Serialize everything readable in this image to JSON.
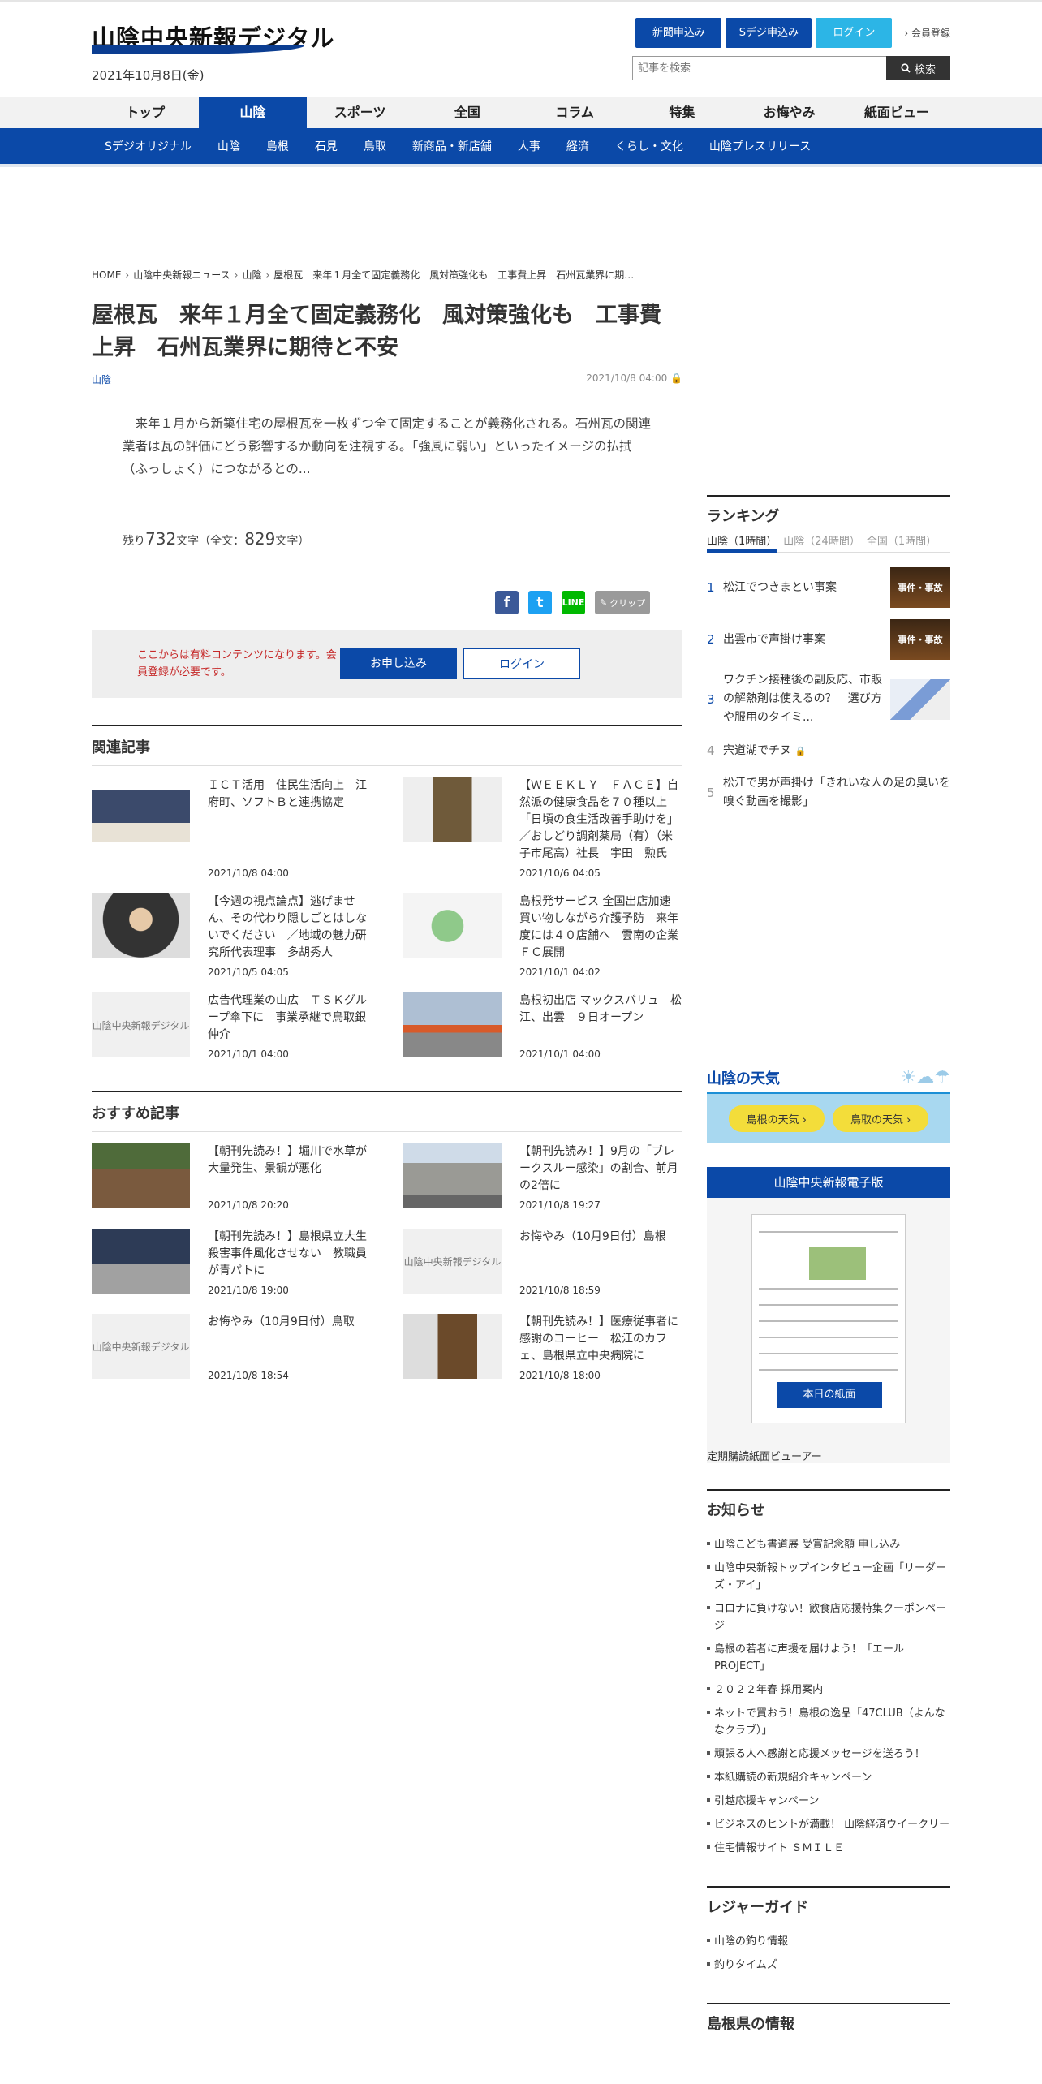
{
  "header": {
    "logo": "山陰中央新報デジタル",
    "date": "2021年10月8日(金)",
    "btn_subscribe": "新聞申込み",
    "btn_sdigi": "Sデジ申込み",
    "btn_login": "ログイン",
    "member": "会員登録",
    "search_placeholder": "記事を検索",
    "search_btn": "検索"
  },
  "gnav": [
    "トップ",
    "山陰",
    "スポーツ",
    "全国",
    "コラム",
    "特集",
    "お悔やみ",
    "紙面ビュー"
  ],
  "snav": [
    "Sデジオリジナル",
    "山陰",
    "島根",
    "石見",
    "鳥取",
    "新商品・新店舗",
    "人事",
    "経済",
    "くらし・文化",
    "山陰プレスリリース"
  ],
  "breadcrumb": [
    "HOME",
    "山陰中央新報ニュース",
    "山陰",
    "屋根瓦　来年１月全て固定義務化　風対策強化も　工事費上昇　石州瓦業界に期…"
  ],
  "article": {
    "title": "屋根瓦　来年１月全て固定義務化　風対策強化も　工事費上昇　石州瓦業界に期待と不安",
    "category": "山陰",
    "timestamp": "2021/10/8 04:00",
    "lead": "来年１月から新築住宅の屋根瓦を一枚ずつ全て固定することが義務化される。石州瓦の関連業者は瓦の評価にどう影響するか動向を注視する。「強風に弱い」といったイメージの払拭（ふっしょく）につながるとの...",
    "remain_pre": "残り",
    "remain_num": "732",
    "remain_mid": "文字（全文：",
    "total_num": "829",
    "remain_post": "文字）",
    "clip": "クリップ",
    "paywall_msg": "ここからは有料コンテンツになります。会員登録が必要です。",
    "apply": "お申し込み",
    "login": "ログイン"
  },
  "related": {
    "title": "関連記事",
    "items": [
      {
        "title": "ＩＣＴ活用　住民生活向上　江府町、ソフトＢと連携協定",
        "date": "2021/10/8 04:00"
      },
      {
        "title": "【ＷＥＥＫＬＹ　ＦＡＣＥ】自然派の健康食品を７０種以上「日頃の食生活改善手助けを」　／おしどり調剤薬局（有）（米子市尾高）社長　宇田　勲氏",
        "date": "2021/10/6 04:05"
      },
      {
        "title": "【今週の視点論点】逃げません、その代わり隠しごとはしないでください　／地域の魅力研究所代表理事　多胡秀人",
        "date": "2021/10/5 04:05"
      },
      {
        "title": "島根発サービス 全国出店加速 買い物しながら介護予防　来年度には４０店舗へ　雲南の企業ＦＣ展開",
        "date": "2021/10/1 04:02"
      },
      {
        "title": "広告代理業の山広　ＴＳＫグループ傘下に　事業承継で鳥取銀仲介",
        "date": "2021/10/1 04:00"
      },
      {
        "title": "島根初出店 マックスバリュ　松江、出雲　９日オープン",
        "date": "2021/10/1 04:00"
      }
    ]
  },
  "recommended": {
    "title": "おすすめ記事",
    "items": [
      {
        "title": "【朝刊先読み！】堀川で水草が大量発生、景観が悪化",
        "date": "2021/10/8 20:20"
      },
      {
        "title": "【朝刊先読み！】9月の「ブレークスルー感染」の割合、前月の2倍に",
        "date": "2021/10/8 19:27"
      },
      {
        "title": "【朝刊先読み！】島根県立大生殺害事件風化させない　教職員が青パトに",
        "date": "2021/10/8 19:00"
      },
      {
        "title": "お悔やみ（10月9日付）島根",
        "date": "2021/10/8 18:59"
      },
      {
        "title": "お悔やみ（10月9日付）鳥取",
        "date": "2021/10/8 18:54"
      },
      {
        "title": "【朝刊先読み！】医療従事者に感謝のコーヒー　松江のカフェ、島根県立中央病院に",
        "date": "2021/10/8 18:00"
      }
    ]
  },
  "placeholder_logo": "山陰中央新報デジタル",
  "ranking": {
    "title": "ランキング",
    "tabs": [
      "山陰（1時間）",
      "山陰（24時間）",
      "全国（1時間）"
    ],
    "items": [
      {
        "num": "1",
        "title": "松江でつきまとい事案",
        "img": "事件・事故"
      },
      {
        "num": "2",
        "title": "出雲市で声掛け事案",
        "img": "事件・事故"
      },
      {
        "num": "3",
        "title": "ワクチン接種後の副反応、市販の解熱剤は使えるの？　選び方や服用のタイミ...",
        "img": ""
      },
      {
        "num": "4",
        "title": "宍道湖でチヌ",
        "img": ""
      },
      {
        "num": "5",
        "title": "松江で男が声掛け「きれいな人の足の臭いを嗅ぐ動画を撮影」",
        "img": ""
      }
    ]
  },
  "weather": {
    "title": "山陰の天気",
    "shimane": "島根の天気",
    "tottori": "鳥取の天気"
  },
  "epaper": {
    "title": "山陰中央新報電子版",
    "today": "本日の紙面",
    "sub": "定期購読",
    "viewer": "紙面ビューアー"
  },
  "news": {
    "title": "お知らせ",
    "items": [
      "山陰こども書道展 受賞記念額 申し込み",
      "山陰中央新報トップインタビュー企画「リーダーズ・アイ」",
      "コロナに負けない！飲食店応援特集クーポンページ",
      "島根の若者に声援を届けよう！「エールPROJECT」",
      "２０２２年春 採用案内",
      "ネットで買おう！島根の逸品「47CLUB（よんななクラブ）」",
      "頑張る人へ感謝と応援メッセージを送ろう！",
      "本紙購読の新規紹介キャンペーン",
      "引越応援キャンペーン",
      "ビジネスのヒントが満載！ 山陰経済ウイークリー",
      "住宅情報サイト ＳＭＩＬＥ"
    ]
  },
  "leisure": {
    "title": "レジャーガイド",
    "items": [
      "山陰の釣り情報",
      "釣りタイムズ"
    ]
  },
  "shimane_info": {
    "title": "島根県の情報"
  }
}
